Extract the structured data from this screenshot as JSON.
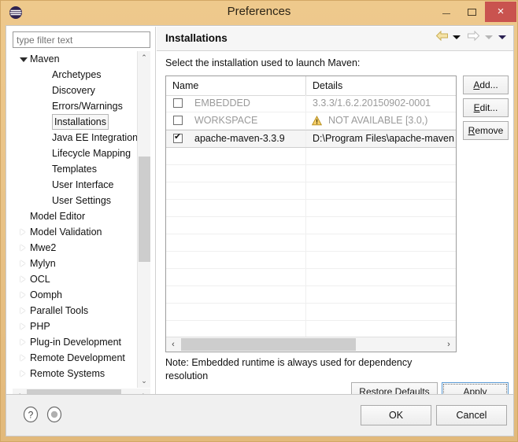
{
  "window": {
    "title": "Preferences",
    "app_icon": "eclipse-icon",
    "minimize_label": "–",
    "maximize_label": "□",
    "close_label": "×",
    "frame_color": "#e6c186",
    "close_color": "#c9534f"
  },
  "filter": {
    "placeholder": "type filter text",
    "value": ""
  },
  "tree": {
    "items": [
      {
        "label": "Maven",
        "depth": 0,
        "state": "expanded",
        "selected": false
      },
      {
        "label": "Archetypes",
        "depth": 1,
        "state": "leaf",
        "selected": false
      },
      {
        "label": "Discovery",
        "depth": 1,
        "state": "leaf",
        "selected": false
      },
      {
        "label": "Errors/Warnings",
        "depth": 1,
        "state": "leaf",
        "selected": false
      },
      {
        "label": "Installations",
        "depth": 1,
        "state": "leaf",
        "selected": true
      },
      {
        "label": "Java EE Integration",
        "depth": 1,
        "state": "leaf",
        "selected": false
      },
      {
        "label": "Lifecycle Mapping",
        "depth": 1,
        "state": "leaf",
        "selected": false
      },
      {
        "label": "Templates",
        "depth": 1,
        "state": "leaf",
        "selected": false
      },
      {
        "label": "User Interface",
        "depth": 1,
        "state": "leaf",
        "selected": false
      },
      {
        "label": "User Settings",
        "depth": 1,
        "state": "leaf",
        "selected": false
      },
      {
        "label": "Model Editor",
        "depth": 0,
        "state": "leaf",
        "selected": false
      },
      {
        "label": "Model Validation",
        "depth": 0,
        "state": "collapsed",
        "selected": false
      },
      {
        "label": "Mwe2",
        "depth": 0,
        "state": "collapsed",
        "selected": false
      },
      {
        "label": "Mylyn",
        "depth": 0,
        "state": "collapsed",
        "selected": false
      },
      {
        "label": "OCL",
        "depth": 0,
        "state": "collapsed",
        "selected": false
      },
      {
        "label": "Oomph",
        "depth": 0,
        "state": "collapsed",
        "selected": false
      },
      {
        "label": "Parallel Tools",
        "depth": 0,
        "state": "collapsed",
        "selected": false
      },
      {
        "label": "PHP",
        "depth": 0,
        "state": "collapsed",
        "selected": false
      },
      {
        "label": "Plug-in Development",
        "depth": 0,
        "state": "collapsed",
        "selected": false
      },
      {
        "label": "Remote Development",
        "depth": 0,
        "state": "collapsed",
        "selected": false
      },
      {
        "label": "Remote Systems",
        "depth": 0,
        "state": "collapsed",
        "selected": false
      }
    ],
    "scroll_up_glyph": "⌃",
    "scroll_down_glyph": "⌄",
    "scroll_left_glyph": "‹",
    "scroll_right_glyph": "›"
  },
  "page": {
    "title": "Installations",
    "description": "Select the installation used to launch Maven:",
    "toolbar": {
      "back_icon": "arrow-left-icon",
      "back_menu_icon": "chevron-down-icon",
      "forward_icon": "arrow-right-icon",
      "forward_menu_icon": "chevron-down-icon",
      "view_menu_icon": "chevron-down-icon",
      "back_color": "#f2dfa0",
      "forward_color": "#ffffff"
    },
    "note": "Note: Embedded runtime is always used for dependency resolution"
  },
  "table": {
    "columns": [
      "Name",
      "Details"
    ],
    "rows": [
      {
        "checked": false,
        "name": "EMBEDDED",
        "details": "3.3.3/1.6.2.20150902-0001",
        "warning": false,
        "enabled": false,
        "selected": false
      },
      {
        "checked": false,
        "name": "WORKSPACE",
        "details": "NOT AVAILABLE [3.0,)",
        "warning": true,
        "enabled": false,
        "selected": false
      },
      {
        "checked": true,
        "name": "apache-maven-3.3.9",
        "details": "D:\\Program Files\\apache-maven",
        "warning": false,
        "enabled": true,
        "selected": true
      }
    ],
    "empty_row_count": 11,
    "scroll_left_glyph": "‹",
    "scroll_right_glyph": "›"
  },
  "side_buttons": {
    "add": {
      "pre": "",
      "mnemonic": "A",
      "post": "dd..."
    },
    "edit": {
      "pre": "",
      "mnemonic": "E",
      "post": "dit..."
    },
    "remove": {
      "pre": "",
      "mnemonic": "R",
      "post": "emove"
    }
  },
  "page_buttons": {
    "restore": {
      "pre": "Restore ",
      "mnemonic": "D",
      "post": "efaults"
    },
    "apply": {
      "pre": "",
      "mnemonic": "A",
      "post": "pply"
    }
  },
  "footer": {
    "help_icon": "help-question-icon",
    "shell_icon": "command-shell-icon",
    "ok_label": "OK",
    "cancel_label": "Cancel"
  }
}
